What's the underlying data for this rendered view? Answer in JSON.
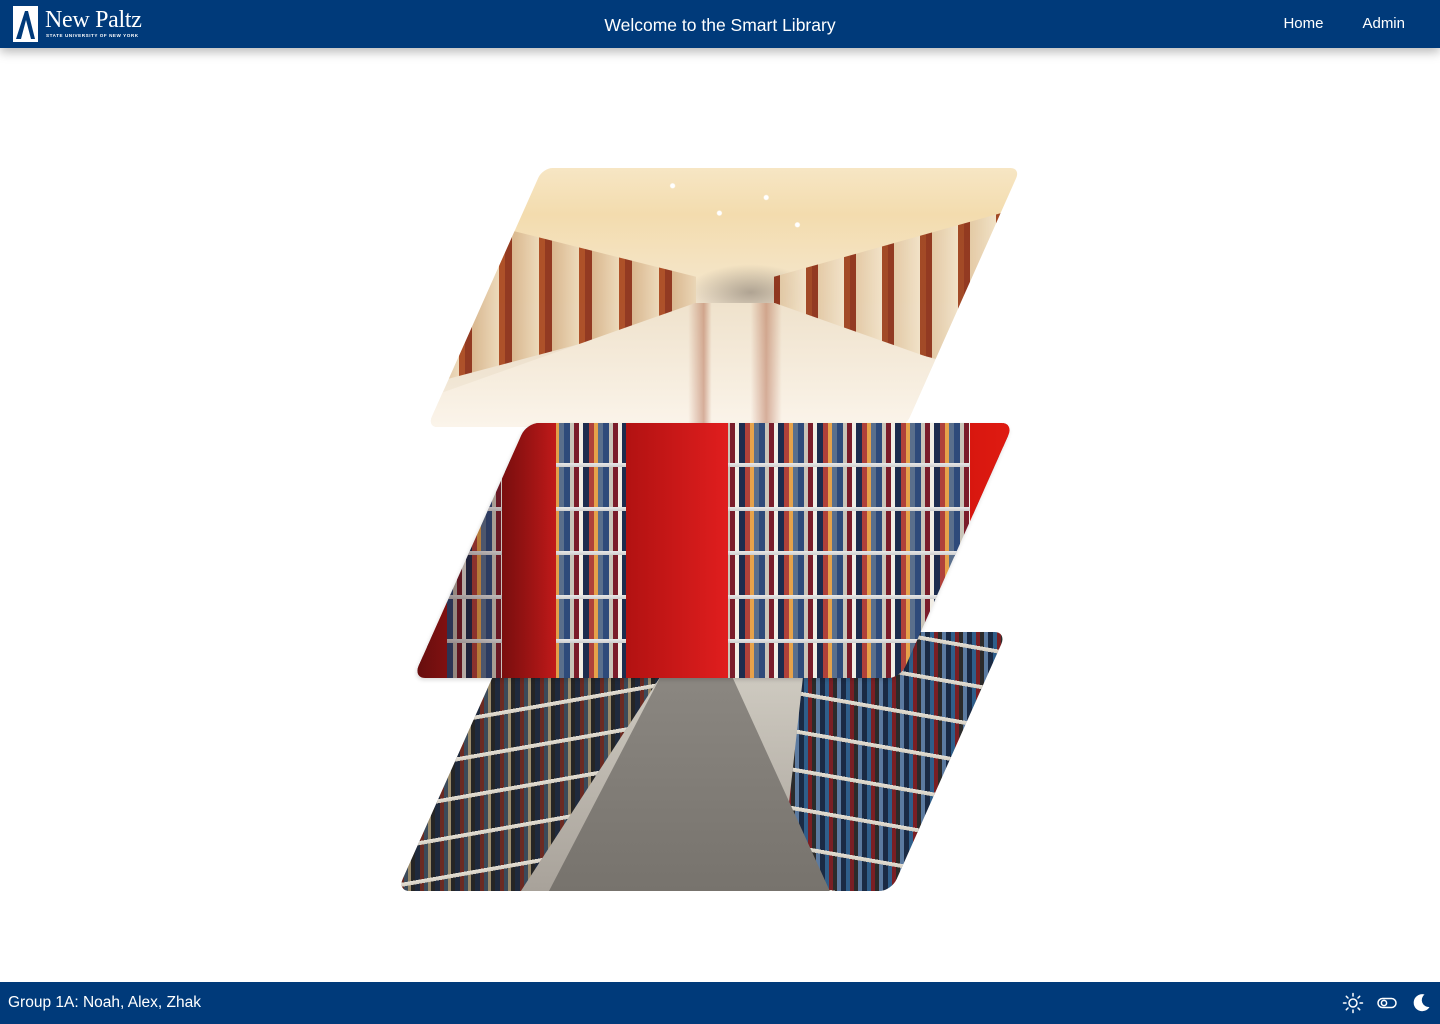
{
  "header": {
    "logo": {
      "wordmark": "New Paltz",
      "subline": "STATE UNIVERSITY OF NEW YORK",
      "icon": "new-paltz-logo-icon"
    },
    "title": "Welcome to the Smart Library",
    "nav": [
      {
        "label": "Home"
      },
      {
        "label": "Admin"
      }
    ],
    "colors": {
      "background": "#003a7a",
      "text": "#ffffff"
    }
  },
  "main": {
    "images": [
      {
        "name": "library-corridor-image",
        "subject": "library corridor"
      },
      {
        "name": "red-bookshelves-image",
        "subject": "red bookshelves"
      },
      {
        "name": "book-aisle-image",
        "subject": "book aisle"
      }
    ]
  },
  "footer": {
    "credit": "Group 1A: Noah, Alex, Zhak",
    "icons": [
      "sun-icon",
      "toggle-icon",
      "moon-icon"
    ],
    "colors": {
      "background": "#003a7a"
    }
  }
}
